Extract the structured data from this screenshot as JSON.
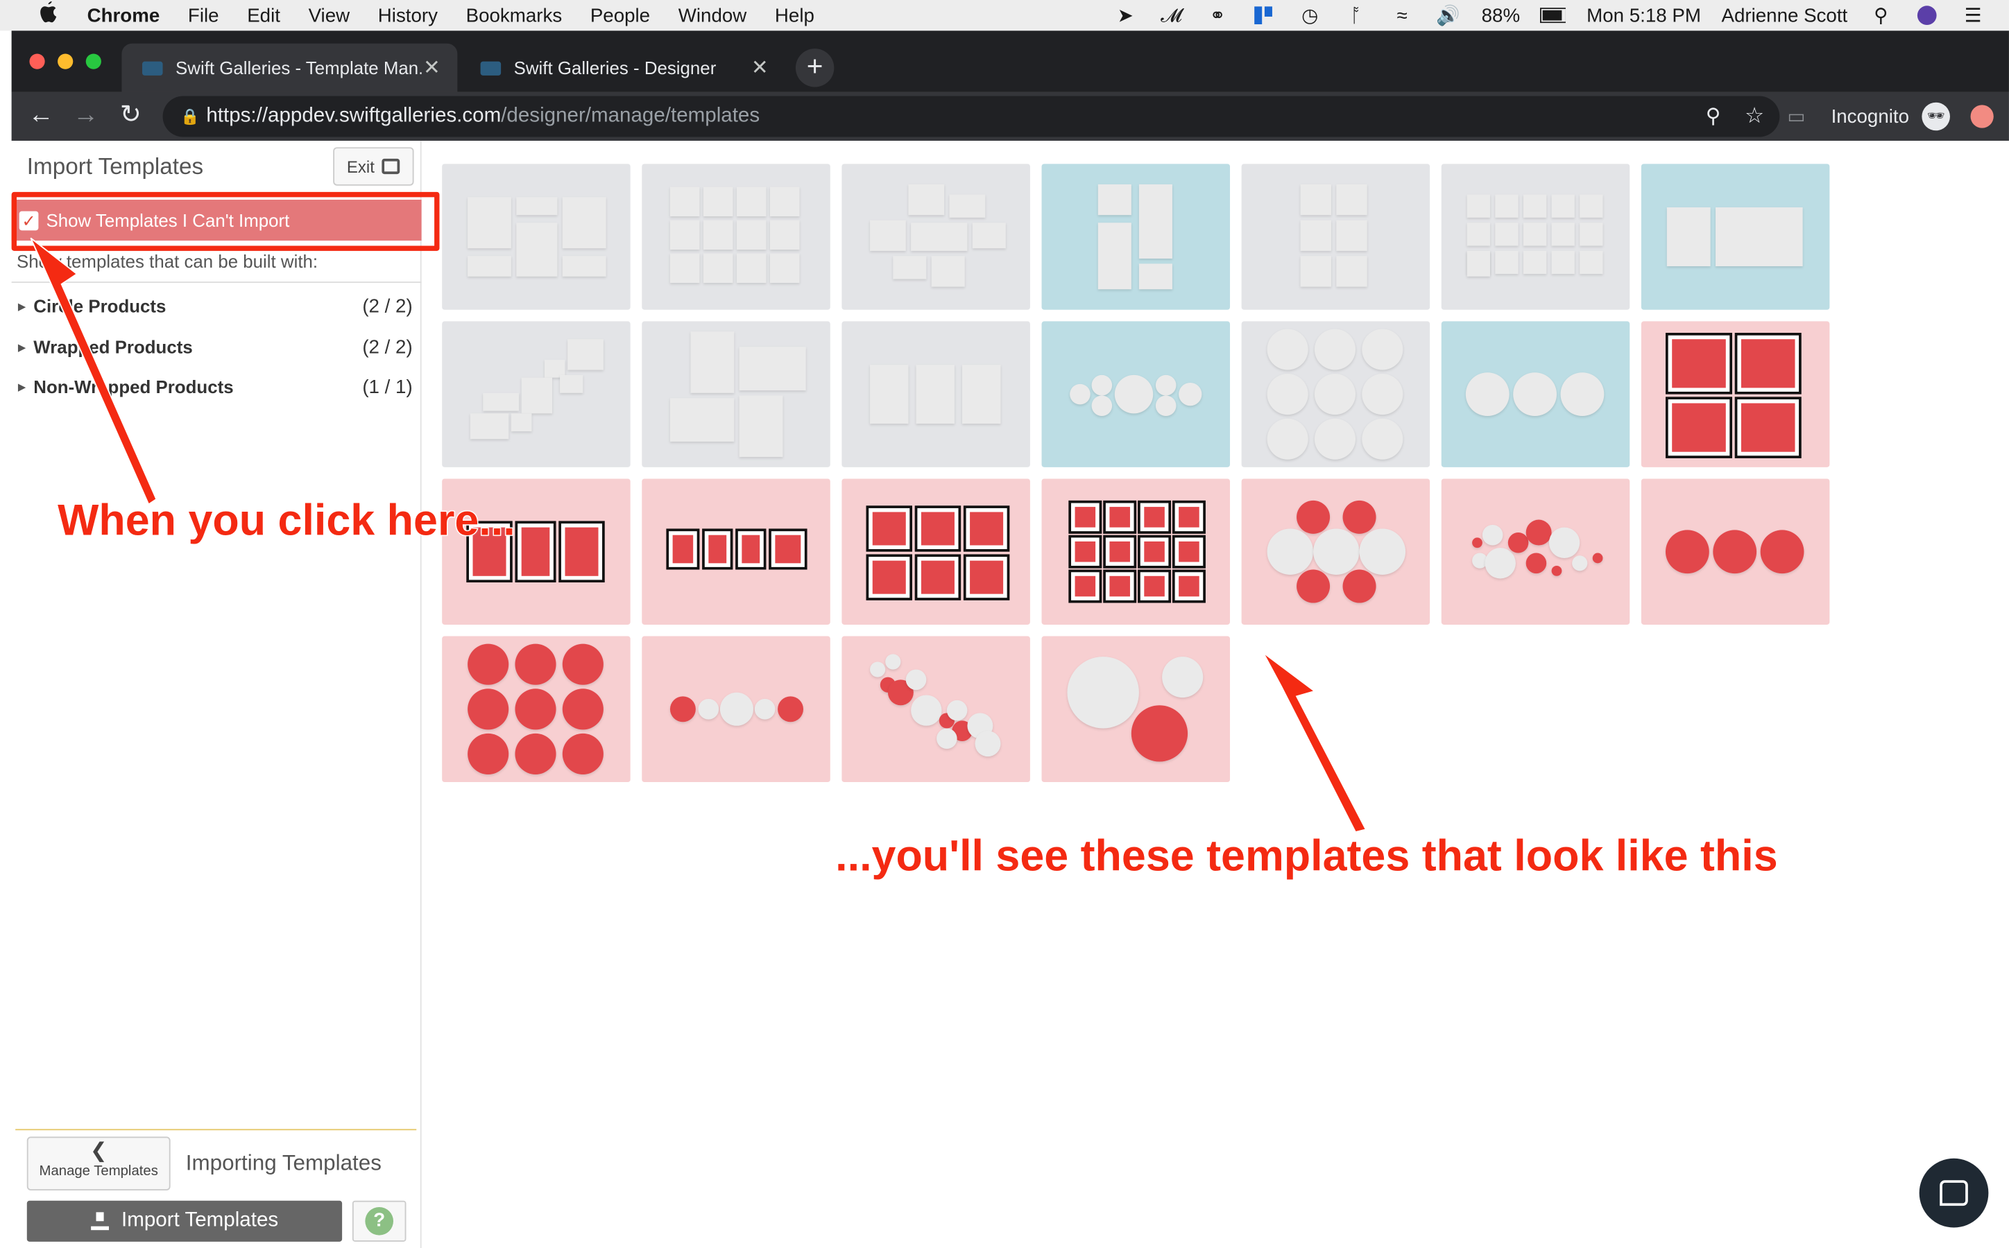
{
  "menubar": {
    "app": "Chrome",
    "items": [
      "File",
      "Edit",
      "View",
      "History",
      "Bookmarks",
      "People",
      "Window",
      "Help"
    ],
    "battery": "88%",
    "clock": "Mon 5:18 PM",
    "user": "Adrienne Scott"
  },
  "browser": {
    "tabs": [
      {
        "title": "Swift Galleries - Template Man..."
      },
      {
        "title": "Swift Galleries - Designer"
      }
    ],
    "url_prefix": "https://",
    "url_host": "appdev.swiftgalleries.com",
    "url_path": "/designer/manage/templates",
    "mode": "Incognito"
  },
  "sidebar": {
    "title": "Import Templates",
    "exit_label": "Exit",
    "show_cant_import_label": "Show Templates I Can't Import",
    "built_with_label": "Show templates that can be built with:",
    "categories": [
      {
        "label": "Circle Products",
        "count": "(2 / 2)"
      },
      {
        "label": "Wrapped Products",
        "count": "(2 / 2)"
      },
      {
        "label": "Non-Wrapped Products",
        "count": "(1 / 1)"
      }
    ],
    "manage_label": "Manage Templates",
    "importing_label": "Importing Templates",
    "import_button_label": "Import Templates",
    "help_label": "?"
  },
  "templates": [
    {
      "style": "gray",
      "layout": "collage-a"
    },
    {
      "style": "gray",
      "layout": "grid-3x4"
    },
    {
      "style": "gray",
      "layout": "scatter-a"
    },
    {
      "style": "blue",
      "layout": "collage-b"
    },
    {
      "style": "gray",
      "layout": "grid-2x3"
    },
    {
      "style": "gray",
      "layout": "grid-3x5"
    },
    {
      "style": "blue",
      "layout": "duo"
    },
    {
      "style": "gray",
      "layout": "stairs"
    },
    {
      "style": "gray",
      "layout": "collage-c"
    },
    {
      "style": "gray",
      "layout": "triptych"
    },
    {
      "style": "blue",
      "layout": "circles-row"
    },
    {
      "style": "gray",
      "layout": "circles-3x3"
    },
    {
      "style": "blue",
      "layout": "circles-3"
    },
    {
      "style": "pink",
      "layout": "framed-2x2"
    },
    {
      "style": "pink",
      "layout": "framed-3"
    },
    {
      "style": "pink",
      "layout": "framed-4"
    },
    {
      "style": "pink",
      "layout": "framed-2x3"
    },
    {
      "style": "pink",
      "layout": "framed-3x4"
    },
    {
      "style": "pink",
      "layout": "circles-cluster"
    },
    {
      "style": "pink",
      "layout": "circles-scatter"
    },
    {
      "style": "pink",
      "layout": "red-circles-3"
    },
    {
      "style": "pink",
      "layout": "red-circles-3x3"
    },
    {
      "style": "pink",
      "layout": "circles-line"
    },
    {
      "style": "pink",
      "layout": "circles-diagonal"
    },
    {
      "style": "pink",
      "layout": "circles-big"
    }
  ],
  "annotations": {
    "left_text": "When you click here...",
    "right_text": "...you'll see these templates that look like this"
  },
  "colors": {
    "gray_tile": "#e3e4e7",
    "blue_tile": "#bcdde4",
    "pink_tile": "#f7cfd1",
    "red_shape": "#e2474b",
    "annotation": "#f42a12"
  }
}
